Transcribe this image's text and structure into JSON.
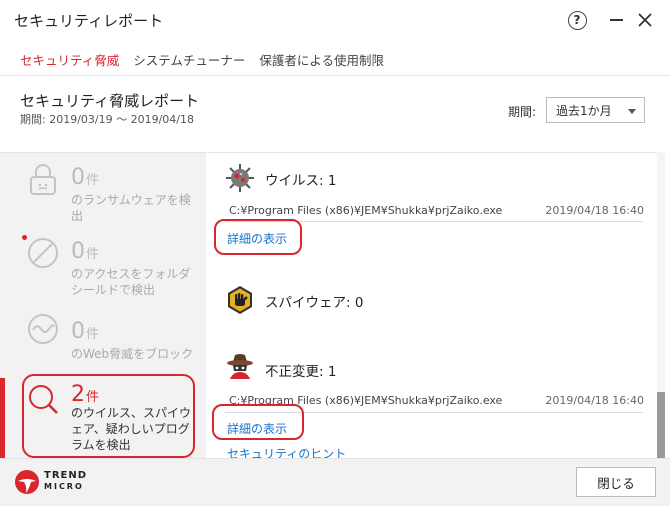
{
  "window": {
    "title": "セキュリティレポート",
    "help_label": "?"
  },
  "nav": {
    "tabs": [
      {
        "label": "セキュリティ脅威",
        "active": true
      },
      {
        "label": "システムチューナー",
        "active": false
      },
      {
        "label": "保護者による使用制限",
        "active": false
      }
    ]
  },
  "report": {
    "title": "セキュリティ脅威レポート",
    "period": "期間: 2019/03/19 ～ 2019/04/18",
    "period_label": "期間:",
    "period_selected": "過去1か月"
  },
  "categories": [
    {
      "count": "0",
      "unit": "件",
      "desc": "のランサムウェアを検出",
      "icon": "lock-icon"
    },
    {
      "count": "0",
      "unit": "件",
      "desc": "のアクセスをフォルダシールドで検出",
      "icon": "blocked-icon"
    },
    {
      "count": "0",
      "unit": "件",
      "desc": "のWeb脅威をブロック",
      "icon": "web-wave-icon"
    },
    {
      "count": "2",
      "unit": "件",
      "desc": "のウイルス、スパイウェア、疑わしいプログラムを検出",
      "icon": "magnifier-icon"
    }
  ],
  "threats": [
    {
      "title": "ウイルス: 1",
      "icon": "virus-icon",
      "path": "C:¥Program Files (x86)¥JEM¥Shukka¥prjZaiko.exe",
      "date": "2019/04/18 16:40",
      "details": "詳細の表示"
    },
    {
      "title": "スパイウェア: 0",
      "icon": "spyware-hand-icon"
    },
    {
      "title": "不正変更: 1",
      "icon": "spy-hat-icon",
      "path": "C:¥Program Files (x86)¥JEM¥Shukka¥prjZaiko.exe",
      "date": "2019/04/18 16:40",
      "details": "詳細の表示"
    }
  ],
  "tips_link": "セキュリティのヒント",
  "footer": {
    "brand_line1": "TREND",
    "brand_line2": "MICRO",
    "close_label": "閉じる"
  },
  "colors": {
    "accent": "#d9262e",
    "link": "#1a73c8"
  }
}
